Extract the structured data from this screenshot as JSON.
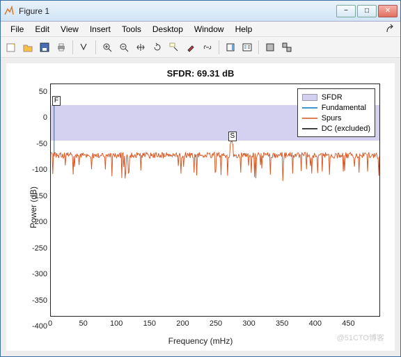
{
  "window_title": "Figure 1",
  "menus": [
    "File",
    "Edit",
    "View",
    "Insert",
    "Tools",
    "Desktop",
    "Window",
    "Help"
  ],
  "chart_data": {
    "type": "line",
    "title": "SFDR:  69.31 dB",
    "xlabel": "Frequency (mHz)",
    "ylabel": "Power (dB)",
    "xlim": [
      0,
      500
    ],
    "ylim": [
      -400,
      50
    ],
    "xticks": [
      0,
      50,
      100,
      150,
      200,
      250,
      300,
      350,
      400,
      450
    ],
    "yticks": [
      50,
      0,
      -50,
      -100,
      -150,
      -200,
      -250,
      -300,
      -350,
      -400
    ],
    "sfdr_band": {
      "from": 10,
      "to": -59
    },
    "fundamental_marker": {
      "x": 5,
      "y": 10,
      "label": "F"
    },
    "spur_marker": {
      "x": 275,
      "y": -59,
      "label": "S"
    },
    "legend": [
      "SFDR",
      "Fundamental",
      "Spurs",
      "DC (excluded)"
    ],
    "series": [
      {
        "name": "Fundamental",
        "note": "single peak at x≈5 from ~-90 dB to ~10 dB",
        "x": 5,
        "peak": 10,
        "floor": -90
      },
      {
        "name": "Spurs",
        "note": "noise floor fluctuating around -85 to -95 dB across 0–500 mHz with spikes down to ~-120 dB; slight peak near x≈275 reaching about -59 dB",
        "mean": -88,
        "min": -130,
        "max": -59
      },
      {
        "name": "DC (excluded)",
        "note": "not drawn (excluded)"
      }
    ]
  },
  "watermark": "@51CTO博客",
  "colors": {
    "sfdr_fill": "#d3d1ef",
    "fundamental": "#0072bd",
    "spurs": "#d9541e",
    "dc": "#000000"
  }
}
